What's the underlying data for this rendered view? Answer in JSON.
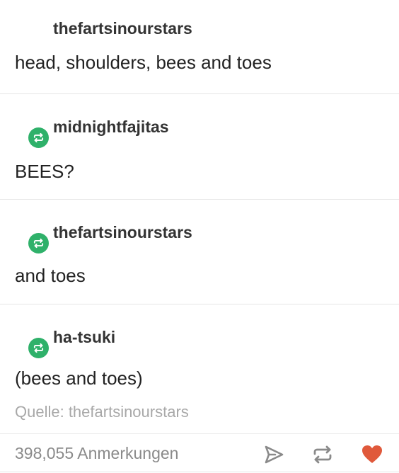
{
  "posts": [
    {
      "username": "thefartsinourstars",
      "text": "head, shoulders, bees and toes",
      "reblog_icon": ""
    },
    {
      "username": "midnightfajitas",
      "text": "BEES?",
      "reblog_icon": "reblog-icon"
    },
    {
      "username": "thefartsinourstars",
      "text": "and toes",
      "reblog_icon": "reblog-icon"
    },
    {
      "username": "ha-tsuki",
      "text": "(bees and toes)",
      "reblog_icon": "reblog-icon"
    }
  ],
  "source": "Quelle: thefartsinourstars",
  "footer": {
    "notes": "398,055 Anmerkungen",
    "icons": [
      "share-icon",
      "reblog-icon",
      "heart-icon"
    ]
  },
  "colors": {
    "reblog_green": "#2fb16a",
    "heart_red": "#e0593b",
    "muted_gray": "#8a8a8a"
  }
}
